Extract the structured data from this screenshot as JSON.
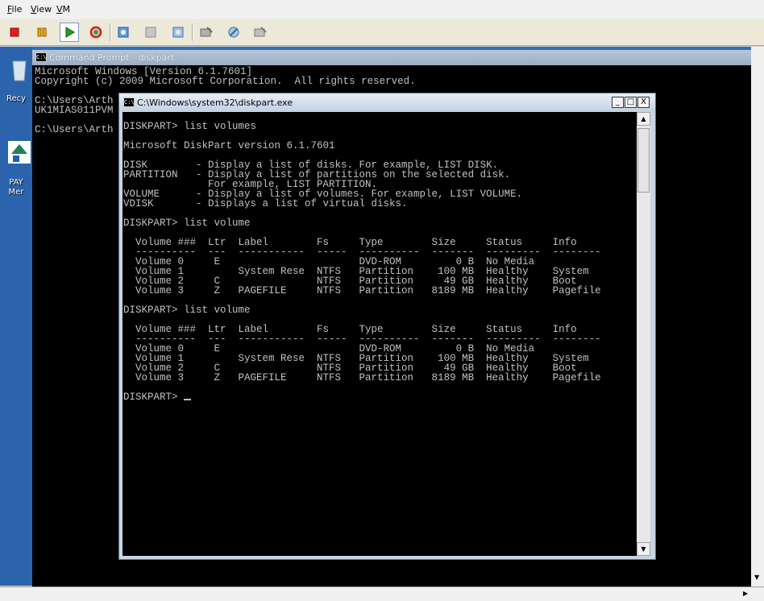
{
  "menu": {
    "file": {
      "ul": "F",
      "rest": "ile"
    },
    "view": {
      "ul": "V",
      "rest": "iew"
    },
    "vm": {
      "ul": "V",
      "rest": "M"
    }
  },
  "toolbar": {
    "icons": [
      "stop-icon",
      "pause-icon",
      "start-icon",
      "reset-icon",
      "snapshot-icon",
      "revert-icon",
      "save-state-icon",
      "ctrl-alt-del-icon",
      "settings-icon",
      "insert-disk-icon"
    ],
    "colors": {
      "stop": "#e02020",
      "pause": "#f0a000",
      "start": "#20a020",
      "reset": "#d03030"
    }
  },
  "desktop": {
    "recycle_label": "Recy",
    "pay_label_1": "PAY",
    "pay_label_2": "Mer"
  },
  "bg_window": {
    "title": "Command Prompt - diskpart",
    "lines": [
      "Microsoft Windows [Version 6.1.7601]",
      "Copyright (c) 2009 Microsoft Corporation.  All rights reserved.",
      "",
      "C:\\Users\\Arth",
      "UK1MIAS011PVM",
      "",
      "C:\\Users\\Arth"
    ]
  },
  "fg_window": {
    "title": "C:\\Windows\\system32\\diskpart.exe",
    "min": "_",
    "max": "□",
    "close": "X",
    "lines": [
      "DISKPART> list volumes",
      "",
      "Microsoft DiskPart version 6.1.7601",
      "",
      "DISK        - Display a list of disks. For example, LIST DISK.",
      "PARTITION   - Display a list of partitions on the selected disk.",
      "              For example, LIST PARTITION.",
      "VOLUME      - Display a list of volumes. For example, LIST VOLUME.",
      "VDISK       - Displays a list of virtual disks.",
      "",
      "DISKPART> list volume",
      "",
      "  Volume ###  Ltr  Label        Fs     Type        Size     Status     Info",
      "  ----------  ---  -----------  -----  ----------  -------  ---------  --------",
      "  Volume 0     E                       DVD-ROM         0 B  No Media",
      "  Volume 1         System Rese  NTFS   Partition    100 MB  Healthy    System",
      "  Volume 2     C                NTFS   Partition     49 GB  Healthy    Boot",
      "  Volume 3     Z   PAGEFILE     NTFS   Partition   8189 MB  Healthy    Pagefile",
      "",
      "DISKPART> list volume",
      "",
      "  Volume ###  Ltr  Label        Fs     Type        Size     Status     Info",
      "  ----------  ---  -----------  -----  ----------  -------  ---------  --------",
      "  Volume 0     E                       DVD-ROM         0 B  No Media",
      "  Volume 1         System Rese  NTFS   Partition    100 MB  Healthy    System",
      "  Volume 2     C                NTFS   Partition     49 GB  Healthy    Boot",
      "  Volume 3     Z   PAGEFILE     NTFS   Partition   8189 MB  Healthy    Pagefile",
      ""
    ],
    "prompt": "DISKPART> "
  }
}
